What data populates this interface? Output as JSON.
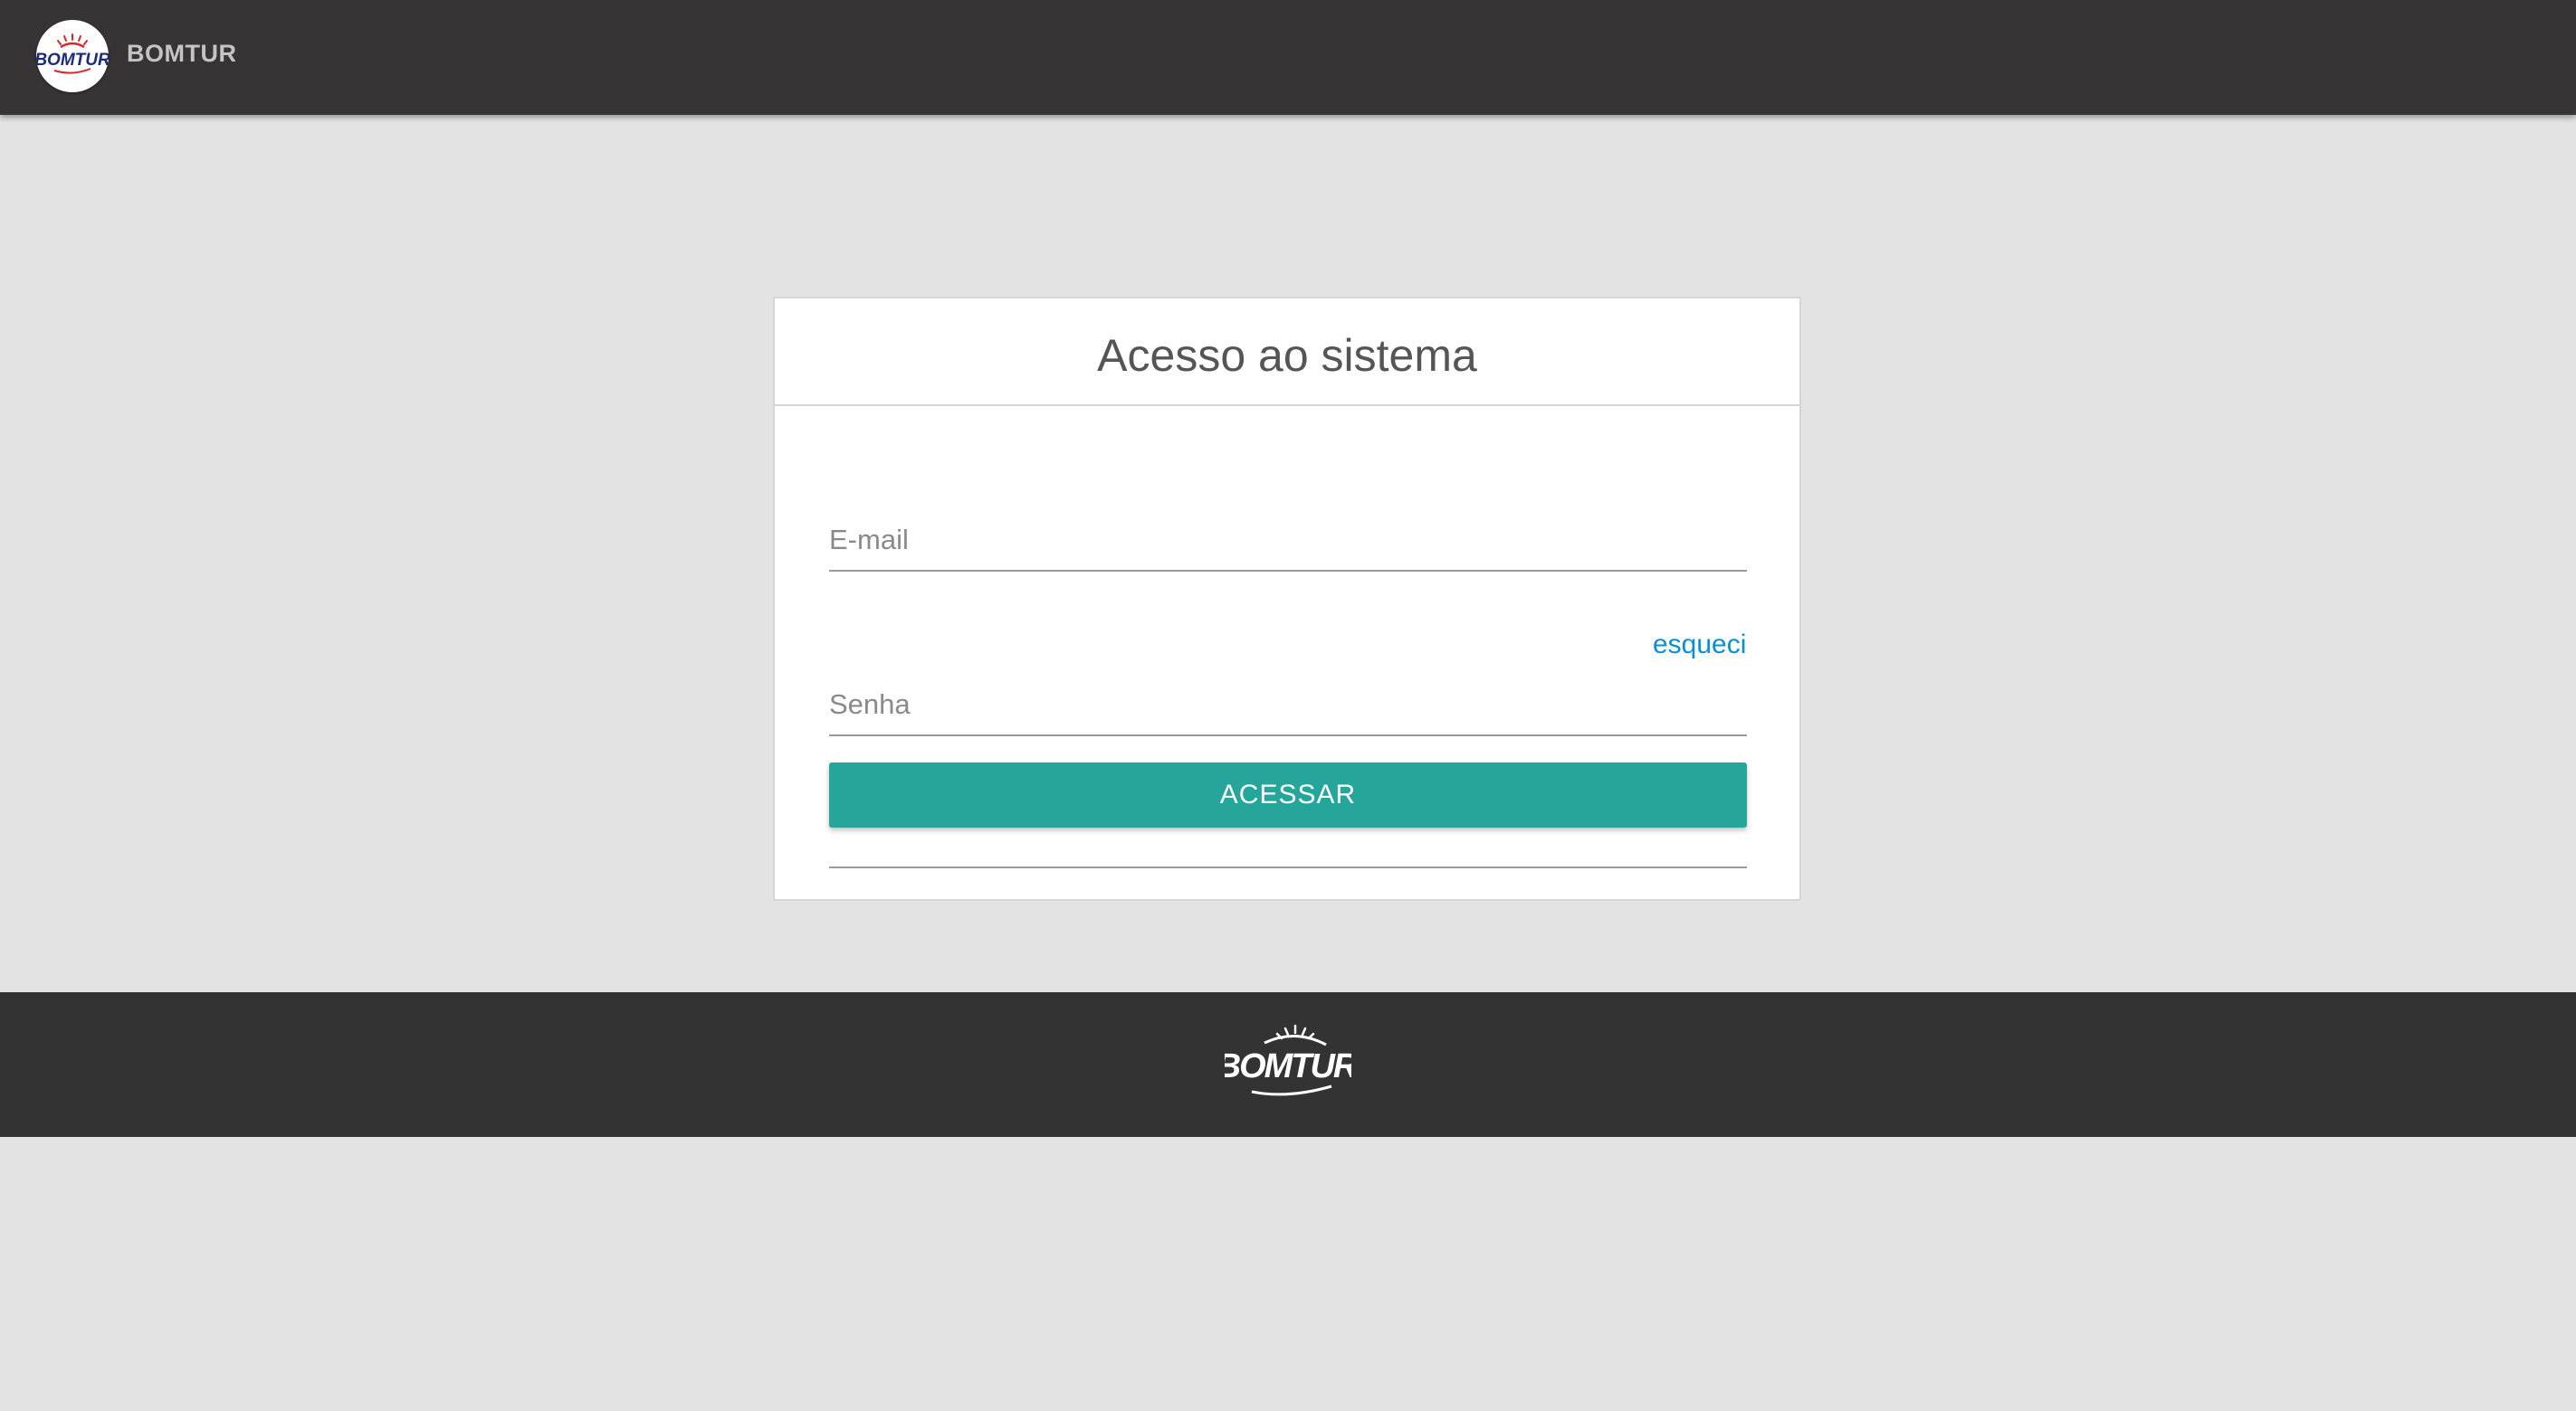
{
  "header": {
    "brand_name": "BOMTUR",
    "logo_text": "BOMTUR"
  },
  "login": {
    "title": "Acesso ao sistema",
    "email_placeholder": "E-mail",
    "email_value": "",
    "forgot_label": "esqueci",
    "password_placeholder": "Senha",
    "password_value": "",
    "submit_label": "ACESSAR"
  },
  "footer": {
    "logo_text": "BOMTUR"
  },
  "colors": {
    "topbar": "#373435",
    "footer": "#333333",
    "background": "#e3e3e3",
    "primary_button": "#26a69a",
    "link": "#0a8fd0"
  },
  "icons": [
    "bomtur-logo-badge",
    "bomtur-logo-footer"
  ]
}
